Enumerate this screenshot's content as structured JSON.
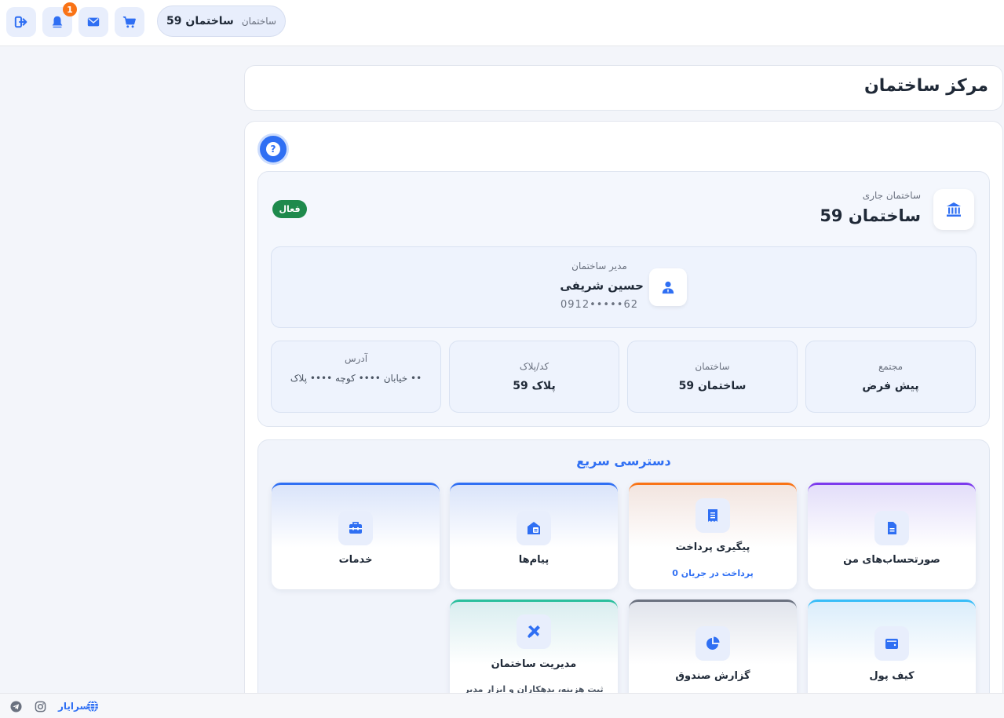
{
  "header": {
    "building_chip": {
      "label": "ساختمان",
      "value": "ساختمان 59"
    },
    "notification_count": "1",
    "icons": [
      "logout-icon",
      "bell-icon",
      "mail-icon",
      "cart-icon"
    ]
  },
  "page": {
    "title": "مرکز ساختمان",
    "help_label": "?"
  },
  "current_building": {
    "label": "ساختمان جاری",
    "name": "ساختمان 59",
    "status": "فعال",
    "manager": {
      "label": "مدیر ساختمان",
      "name": "حسین شریفی",
      "phone": "0912•••••62"
    },
    "info": [
      {
        "label": "مجتمع",
        "value": "پیش فرض"
      },
      {
        "label": "ساختمان",
        "value": "ساختمان 59"
      },
      {
        "label": "کد/پلاک",
        "value": "پلاک 59"
      },
      {
        "label": "آدرس",
        "value": "خیابان •••• کوچه •••• پلاک ••"
      }
    ]
  },
  "quick_access": {
    "title": "دسترسی سریع",
    "tiles": [
      {
        "label": "صورتحساب‌های من",
        "sub": "",
        "color": "#7c3aed",
        "icon": "invoice-icon"
      },
      {
        "label": "پیگیری پرداخت",
        "sub": "0 پرداخت در جریان",
        "color": "#f97316",
        "icon": "receipt-icon"
      },
      {
        "label": "پیام‌ها",
        "sub": "",
        "color": "#2f6ff3",
        "icon": "envelope-open-icon"
      },
      {
        "label": "خدمات",
        "sub": "",
        "color": "#2f6ff3",
        "icon": "toolbox-icon"
      },
      {
        "label": "کیف پول",
        "sub": "",
        "color": "#38bdf8",
        "icon": "wallet-icon"
      },
      {
        "label": "گزارش صندوق",
        "sub": "",
        "color": "#6b7280",
        "icon": "pie-chart-icon"
      },
      {
        "label": "مدیریت ساختمان",
        "sub": "ثبت هزینه، بدهکاران و ابزار مدیر",
        "color": "#2bbf9d",
        "icon": "tools-icon"
      }
    ]
  },
  "footer": {
    "brand": "اسرایار",
    "icons": [
      "globe-icon",
      "instagram-icon",
      "telegram-icon"
    ]
  },
  "colors": {
    "primary": "#2f6ff3",
    "success": "#1e8a4c",
    "badge": "#f97316"
  }
}
